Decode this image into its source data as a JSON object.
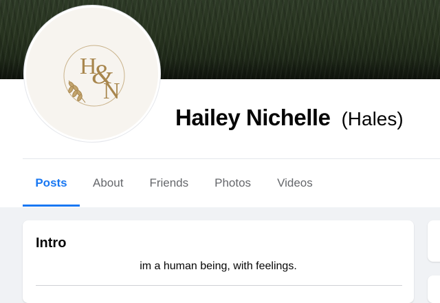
{
  "profile": {
    "name": "Hailey Nichelle",
    "nickname": "(Hales)",
    "avatar_monogram": {
      "letter_top": "H",
      "ampersand": "&",
      "letter_bottom": "N",
      "color": "#a8864d"
    }
  },
  "tabs": [
    {
      "label": "Posts",
      "active": true
    },
    {
      "label": "About",
      "active": false
    },
    {
      "label": "Friends",
      "active": false
    },
    {
      "label": "Photos",
      "active": false
    },
    {
      "label": "Videos",
      "active": false
    }
  ],
  "intro": {
    "title": "Intro",
    "bio": "im a human being, with feelings."
  },
  "colors": {
    "accent": "#1877f2",
    "background": "#f0f2f5",
    "text_secondary": "#65676b"
  }
}
